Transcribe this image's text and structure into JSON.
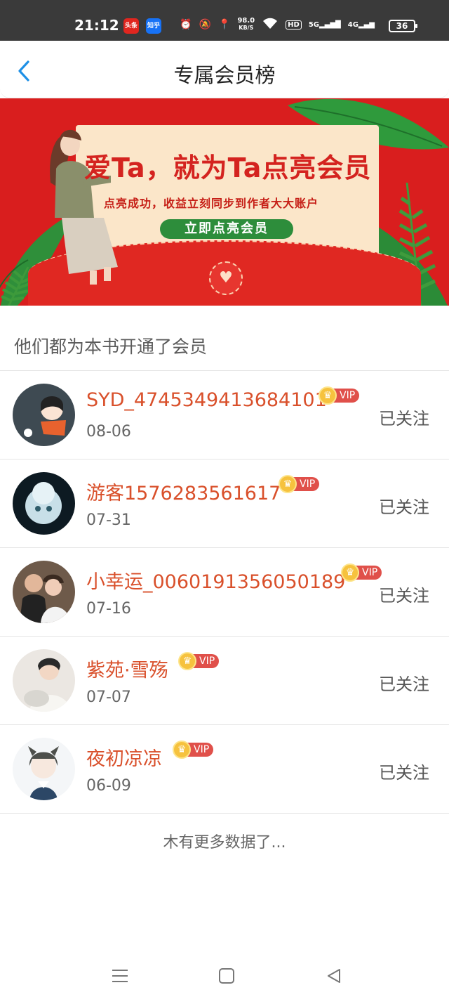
{
  "status_bar": {
    "time": "21:12",
    "apps": [
      "头条",
      "知乎"
    ],
    "net_speed_value": "98.0",
    "net_speed_unit": "KB/S",
    "hd_label": "HD",
    "sig1_label": "5G",
    "sig2_label": "4G",
    "battery": "36"
  },
  "header": {
    "title": "专属会员榜"
  },
  "banner": {
    "headline": "爱Ta，就为Ta点亮会员",
    "subline": "点亮成功，收益立刻同步到作者大大账户",
    "cta_label": "立即点亮会员"
  },
  "section": {
    "title": "他们都为本书开通了会员"
  },
  "members": [
    {
      "name": "SYD_4745349413684101",
      "date": "08-06",
      "vip": "VIP",
      "follow": "已关注"
    },
    {
      "name": "游客1576283561617",
      "date": "07-31",
      "vip": "VIP",
      "follow": "已关注"
    },
    {
      "name": "小幸运_0060191356050189",
      "date": "07-16",
      "vip": "VIP",
      "follow": "已关注"
    },
    {
      "name": "紫苑·雪殇",
      "date": "07-07",
      "vip": "VIP",
      "follow": "已关注"
    },
    {
      "name": "夜初凉凉",
      "date": "06-09",
      "vip": "VIP",
      "follow": "已关注"
    }
  ],
  "footer": {
    "no_more": "木有更多数据了..."
  },
  "colors": {
    "accent_name": "#d9502b",
    "back_arrow": "#1e90e6",
    "banner_red": "#d91e1e",
    "vip_red": "#e0504a"
  },
  "icons": [
    "back-arrow-icon",
    "alarm-icon",
    "mute-icon",
    "location-icon",
    "wifi-icon",
    "battery-icon",
    "vip-crown-icon",
    "menu-nav-icon",
    "home-nav-icon",
    "back-nav-icon"
  ]
}
